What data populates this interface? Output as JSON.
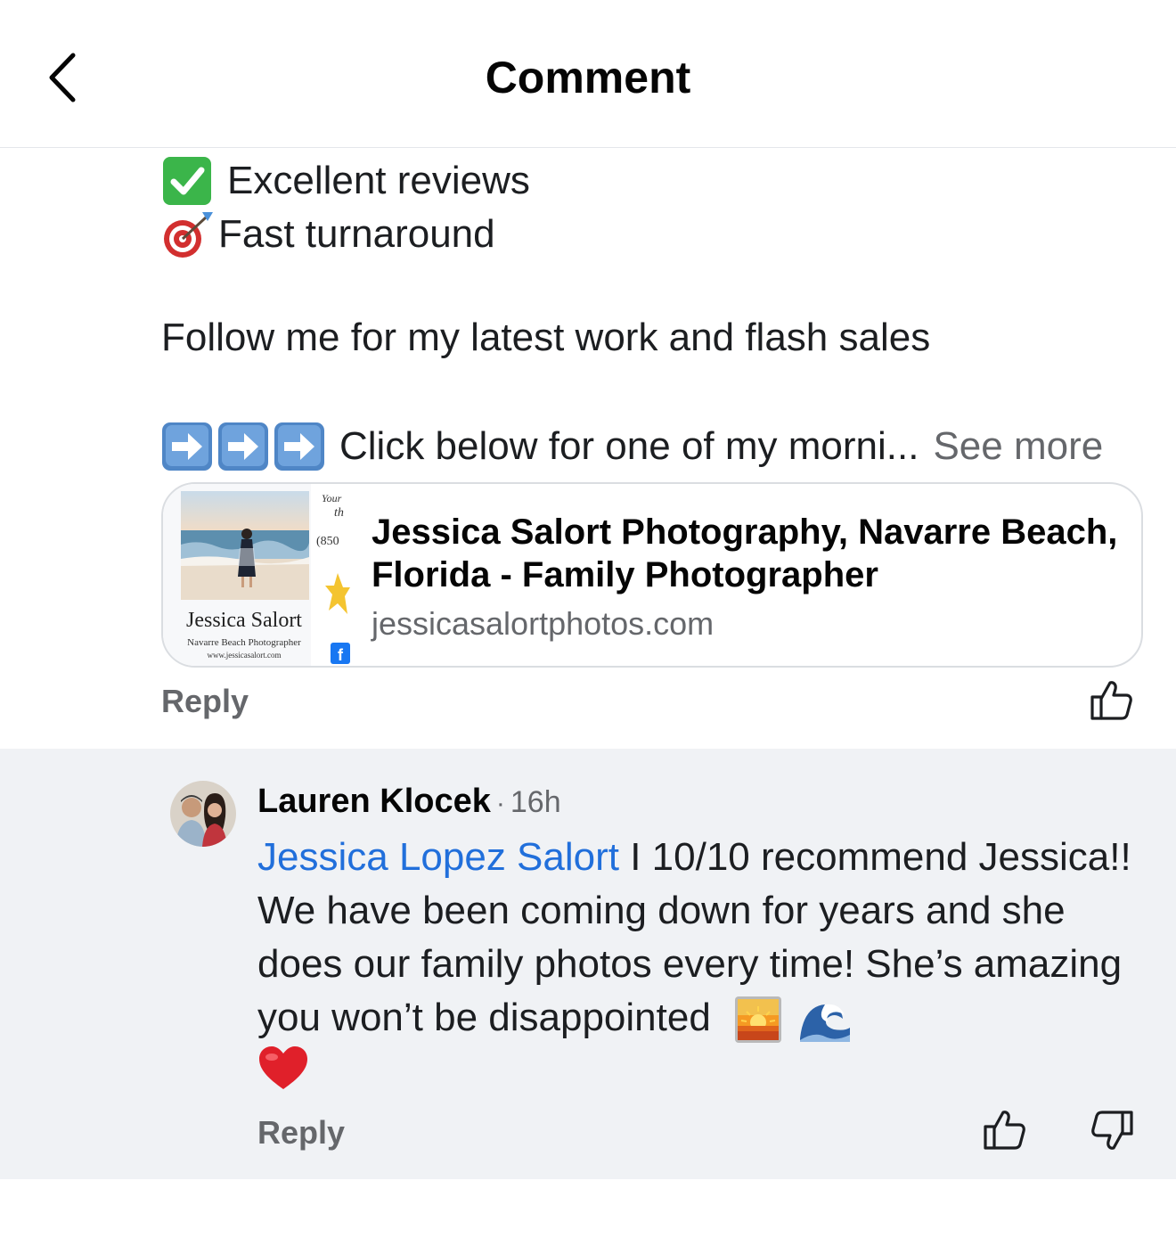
{
  "header": {
    "title": "Comment",
    "back_icon": "chevron-left-icon"
  },
  "post": {
    "line1": {
      "icon": "check-mark-button-icon",
      "text": "Excellent reviews"
    },
    "line2": {
      "icon": "direct-hit-icon",
      "text": "Fast turnaround"
    },
    "line3": "Follow me for my latest work and flash sales",
    "line4": {
      "icon": "right-arrow-icon",
      "text": "Click below for one of my morni...",
      "see_more": "See more"
    },
    "link_card": {
      "title": "Jessica Salort Photography, Navarre Beach, Florida - Family Photographer",
      "domain": "jessicasalortphotos.com",
      "thumbnail": {
        "name": "Jessica Salort",
        "subtitle": "Navarre Beach Photographer",
        "url": "www.jessicasalort.com",
        "side_text": [
          "Your",
          "th",
          "(850"
        ]
      }
    },
    "reply_label": "Reply",
    "like_icon": "thumbs-up-icon"
  },
  "comment": {
    "author": "Lauren Klocek",
    "separator": "·",
    "time": "16h",
    "mention": "Jessica Lopez Salort",
    "text": " I 10/10 recommend Jessica!! We have been coming down for years and she does our family photos every time! She’s amazing you won’t be disappointed",
    "emojis": [
      "sunrise-icon",
      "water-wave-icon",
      "red-heart-icon"
    ],
    "reply_label": "Reply",
    "like_icon": "thumbs-up-icon",
    "dislike_icon": "thumbs-down-icon"
  },
  "colors": {
    "accent_link": "#216fdb",
    "secondary_text": "#65676b",
    "comment_bg": "#f0f2f5"
  }
}
